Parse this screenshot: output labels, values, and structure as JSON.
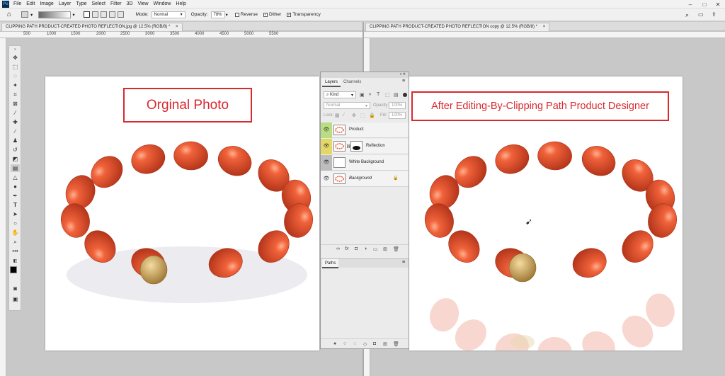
{
  "app": {
    "logo": "Ps"
  },
  "menu": [
    "File",
    "Edit",
    "Image",
    "Layer",
    "Type",
    "Select",
    "Filter",
    "3D",
    "View",
    "Window",
    "Help"
  ],
  "options": {
    "mode_label": "Mode:",
    "mode_value": "Normal",
    "opacity_label": "Opacity:",
    "opacity_value": "78%",
    "reverse_label": "Reverse",
    "dither_label": "Dither",
    "transparency_label": "Transparency"
  },
  "tabs": {
    "left": "CLIPPING PATH PRODUCT-CREATED PHOTO REFLECTION.jpg @ 12.5% (RGB/8) *",
    "right": "CLIPPING PATH PRODUCT-CREATED PHOTO REFLECTION copy @ 12.5% (RGB/8) *",
    "close": "×"
  },
  "ruler": [
    "500",
    "1000",
    "1500",
    "2000",
    "2500",
    "3000",
    "3500",
    "4000",
    "4500",
    "5000",
    "5500"
  ],
  "canvas_left": {
    "label": "Orginal Photo"
  },
  "canvas_right": {
    "label": "After Editing-By-Clipping Path Product Designer"
  },
  "layers_panel": {
    "tab_layers": "Layers",
    "tab_channels": "Channels",
    "kind": "Kind",
    "blend": "Normal",
    "opacity_label": "Opacity:",
    "opacity_value": "100%",
    "lock_label": "Lock:",
    "fill_label": "Fill:",
    "fill_value": "100%",
    "layers": [
      {
        "name": "Product"
      },
      {
        "name": "Reflection"
      },
      {
        "name": "White Background"
      },
      {
        "name": "Background"
      }
    ],
    "paths_tab": "Paths"
  },
  "colors": {
    "label_red": "#d8292f",
    "bead": "#e8532f",
    "gold": "#c9a04e"
  }
}
